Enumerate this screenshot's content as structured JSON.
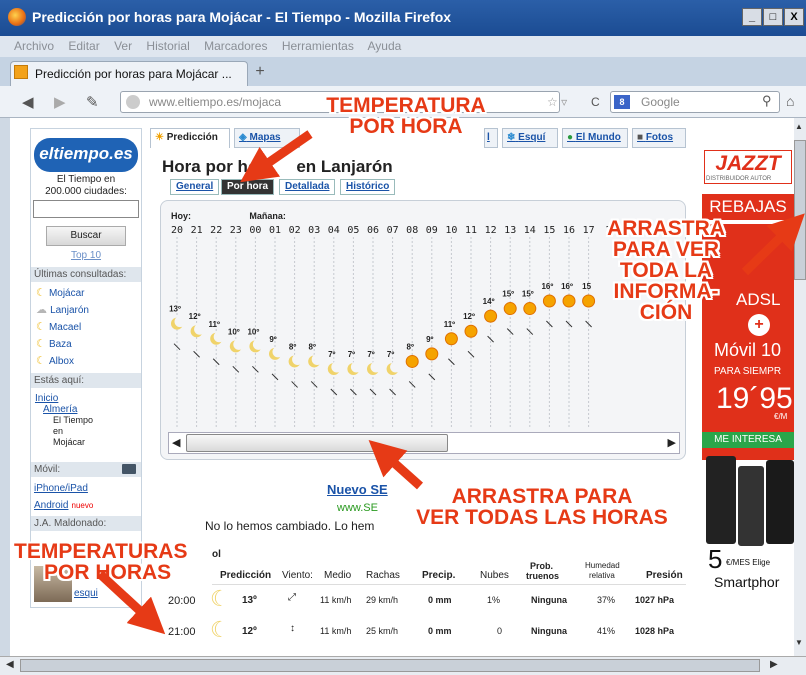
{
  "window": {
    "title": "Predicción por horas para Mojácar - El Tiempo - Mozilla Firefox",
    "min": "_",
    "max": "□",
    "close": "X"
  },
  "menu": [
    "Archivo",
    "Editar",
    "Ver",
    "Historial",
    "Marcadores",
    "Herramientas",
    "Ayuda"
  ],
  "tab": {
    "label": "Predicción por horas para Mojácar ...",
    "new_tab": "+"
  },
  "nav": {
    "url": "www.eltiempo.es/mojaca",
    "search_placeholder": "Google",
    "reload": "C",
    "star": "☆ ▿"
  },
  "sidebar": {
    "logo": "eltiempo.es",
    "tagline1": "El Tiempo en",
    "tagline2": "200.000 ciudades:",
    "search_button": "Buscar",
    "top10": "Top 10",
    "recent_head": "Últimas consultadas:",
    "recent": [
      "Mojácar",
      "Lanjarón",
      "Macael",
      "Baza",
      "Albox"
    ],
    "here_head": "Estás aquí:",
    "breadcrumb": [
      "Inicio",
      "Almería",
      "El Tiempo",
      "en",
      "Mojácar"
    ],
    "mobile_head": "Móvil:",
    "mobile": [
      "iPhone/iPad",
      "Android"
    ],
    "mobile_new": "nuevo",
    "user_head": "J.A. Maldonado:",
    "user_link": "esqui"
  },
  "content_tabs": [
    {
      "label": "Predicción"
    },
    {
      "label": "Mapas"
    },
    {
      "label": "l"
    },
    {
      "label": "Esquí"
    },
    {
      "label": "El Mundo"
    },
    {
      "label": "Fotos"
    }
  ],
  "heading": {
    "part1": "Hora por ho",
    "part2": "en Lanjarón"
  },
  "subtabs": [
    "General",
    "Por hora",
    "Detallada",
    "Histórico"
  ],
  "chart_data": {
    "type": "line",
    "day_labels": [
      "Hoy:",
      "Mañana:"
    ],
    "x": [
      "20",
      "21",
      "22",
      "23",
      "00",
      "01",
      "02",
      "03",
      "04",
      "05",
      "06",
      "07",
      "08",
      "09",
      "10",
      "11",
      "12",
      "13",
      "14",
      "15",
      "16",
      "17"
    ],
    "values": [
      13,
      12,
      11,
      10,
      10,
      9,
      8,
      8,
      7,
      7,
      7,
      7,
      8,
      9,
      11,
      12,
      14,
      15,
      15,
      16,
      16,
      16
    ],
    "labels": [
      "13º",
      "12º",
      "11º",
      "10º",
      "10º",
      "9º",
      "8º",
      "8º",
      "7º",
      "7º",
      "7º",
      "7º",
      "8º",
      "9º",
      "11º",
      "12º",
      "14º",
      "15º",
      "15º",
      "16º",
      "16º",
      "15"
    ],
    "icons": [
      "moon",
      "moon",
      "moon",
      "moon",
      "moon",
      "moon",
      "moon",
      "moon",
      "moon",
      "moon",
      "moon",
      "moon",
      "sun",
      "sun",
      "sun",
      "sun",
      "sun",
      "sun",
      "sun",
      "sun",
      "sun",
      "sun"
    ],
    "partial_tick": "1"
  },
  "promo": {
    "link": "Nuevo SE",
    "url": "www.SE",
    "text": "No lo hemos cambiado. Lo hem",
    "suffix": "ol"
  },
  "table": {
    "headers": [
      "Predicción",
      "Viento:",
      "Medio",
      "Rachas",
      "Precip.",
      "Nubes",
      "Prob.",
      "truenos",
      "Humedad",
      "relativa",
      "Presión"
    ],
    "rows": [
      {
        "hour": "20:00",
        "temp": "13º",
        "wind": "11 km/h",
        "gust": "29 km/h",
        "precip": "0 mm",
        "clouds": "1%",
        "storm": "Ninguna",
        "hum": "37%",
        "press": "1027 hPa"
      },
      {
        "hour": "21:00",
        "temp": "12º",
        "wind": "11 km/h",
        "gust": "25 km/h",
        "precip": "0 mm",
        "clouds": "0",
        "storm": "Ninguna",
        "hum": "41%",
        "press": "1028 hPa"
      }
    ]
  },
  "ad": {
    "brand": "JAZZT",
    "brand_sub": "DISTRIBUIDOR AUTOR",
    "sale": "REBAJAS",
    "adsl": "ADSL",
    "plus": "+",
    "movil": "Móvil 10",
    "para": "PARA SIEMPR",
    "price": "19´95",
    "price_unit": "€/M",
    "cta": "ME INTERESA",
    "bottom_num": "5",
    "bottom_txt": "€/MES Elige",
    "bottom_sub": "Smartphor"
  },
  "callouts": {
    "top1": "TEMPERATURA",
    "top2": "POR HORA",
    "right1": "ARRASTRA",
    "right2": "PARA VER",
    "right3": "TODA LA",
    "right4": "INFORMA-",
    "right5": "CIÓN",
    "mid1": "ARRASTRA PARA",
    "mid2": "VER TODAS LAS HORAS",
    "left1": "TEMPERATURAS",
    "left2": "POR HORAS"
  },
  "colors": {
    "accent": "#e63a16",
    "brand": "#1f63b5",
    "sun": "#f5a300",
    "moon": "#f0d36a"
  }
}
